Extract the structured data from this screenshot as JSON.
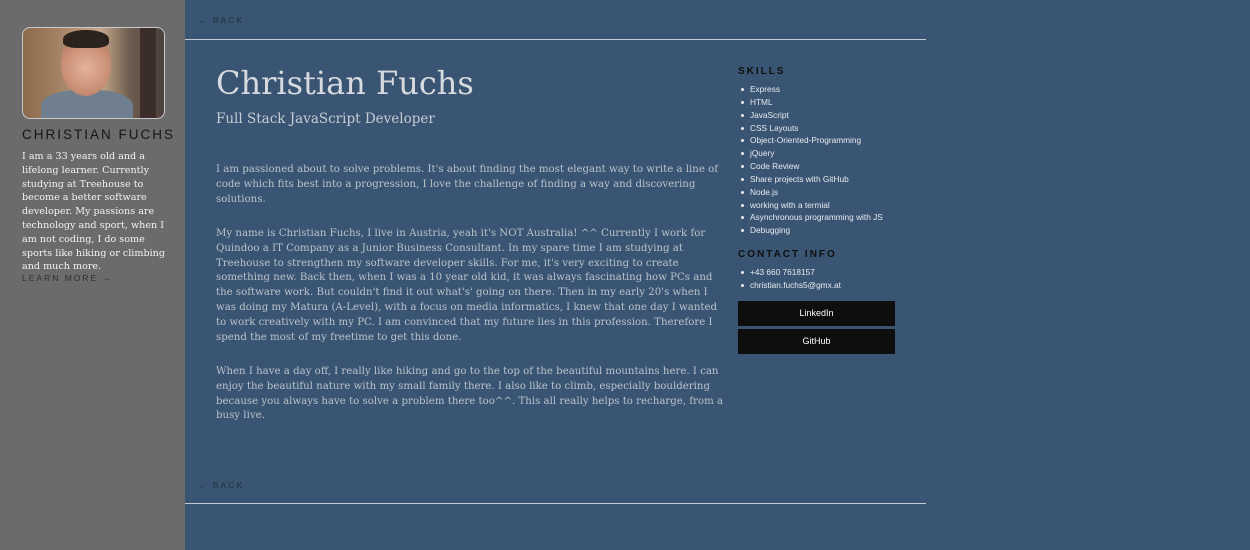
{
  "sidebar": {
    "name": "CHRISTIAN FUCHS",
    "bio": "I am a 33 years old and a lifelong learner. Currently studying at Treehouse to become a better software developer. My passions are technology and sport, when I am not coding, I do some sports like hiking or climbing and much more.",
    "learn_more": "LEARN MORE →"
  },
  "nav": {
    "back_top": "← BACK",
    "back_bottom": "← BACK"
  },
  "main": {
    "title": "Christian Fuchs",
    "subtitle": "Full Stack JavaScript Developer",
    "paragraphs": [
      "I am passioned about to solve problems. It's about finding the most elegant way to write a line of code which fits best into a progression, I love the challenge of finding a way and discovering solutions.",
      "My name is Christian Fuchs, I live in Austria, yeah it's NOT Australia! ^^ Currently I work for Quindoo a IT Company as a Junior Business Consultant. In my spare time I am studying at Treehouse to strengthen my software developer skills. For me, it's very exciting to create something new. Back then, when I was a 10 year old kid, it was always fascinating how PCs and the software work. But couldn't find it out what's' going on there. Then in my early 20's when I was doing my Matura (A-Level), with a focus on media informatics, I knew that one day I wanted to work creatively with my PC. I am convinced that my future lies in this profession. Therefore I spend the most of my freetime to get this done.",
      "When I have a day off, I really like hiking and go to the top of the beautiful mountains here. I can enjoy the beautiful nature with my small family there. I also like to climb, especially bouldering because you always have to solve a problem there too^^. This all really helps to recharge, from a busy live."
    ]
  },
  "aside": {
    "skills_heading": "SKILLS",
    "skills": [
      "Express",
      "HTML",
      "JavaScript",
      "CSS Layouts",
      "Object-Oriented-Programming",
      "jQuery",
      "Code Review",
      "Share projects with GitHub",
      "Node.js",
      "working with a termial",
      "Asynchronous programming with JS",
      "Debugging"
    ],
    "contact_heading": "CONTACT INFO",
    "contact": [
      "+43 660 7618157",
      "christian.fuchs5@gmx.at"
    ],
    "linkedin_label": "LinkedIn",
    "github_label": "GitHub"
  }
}
